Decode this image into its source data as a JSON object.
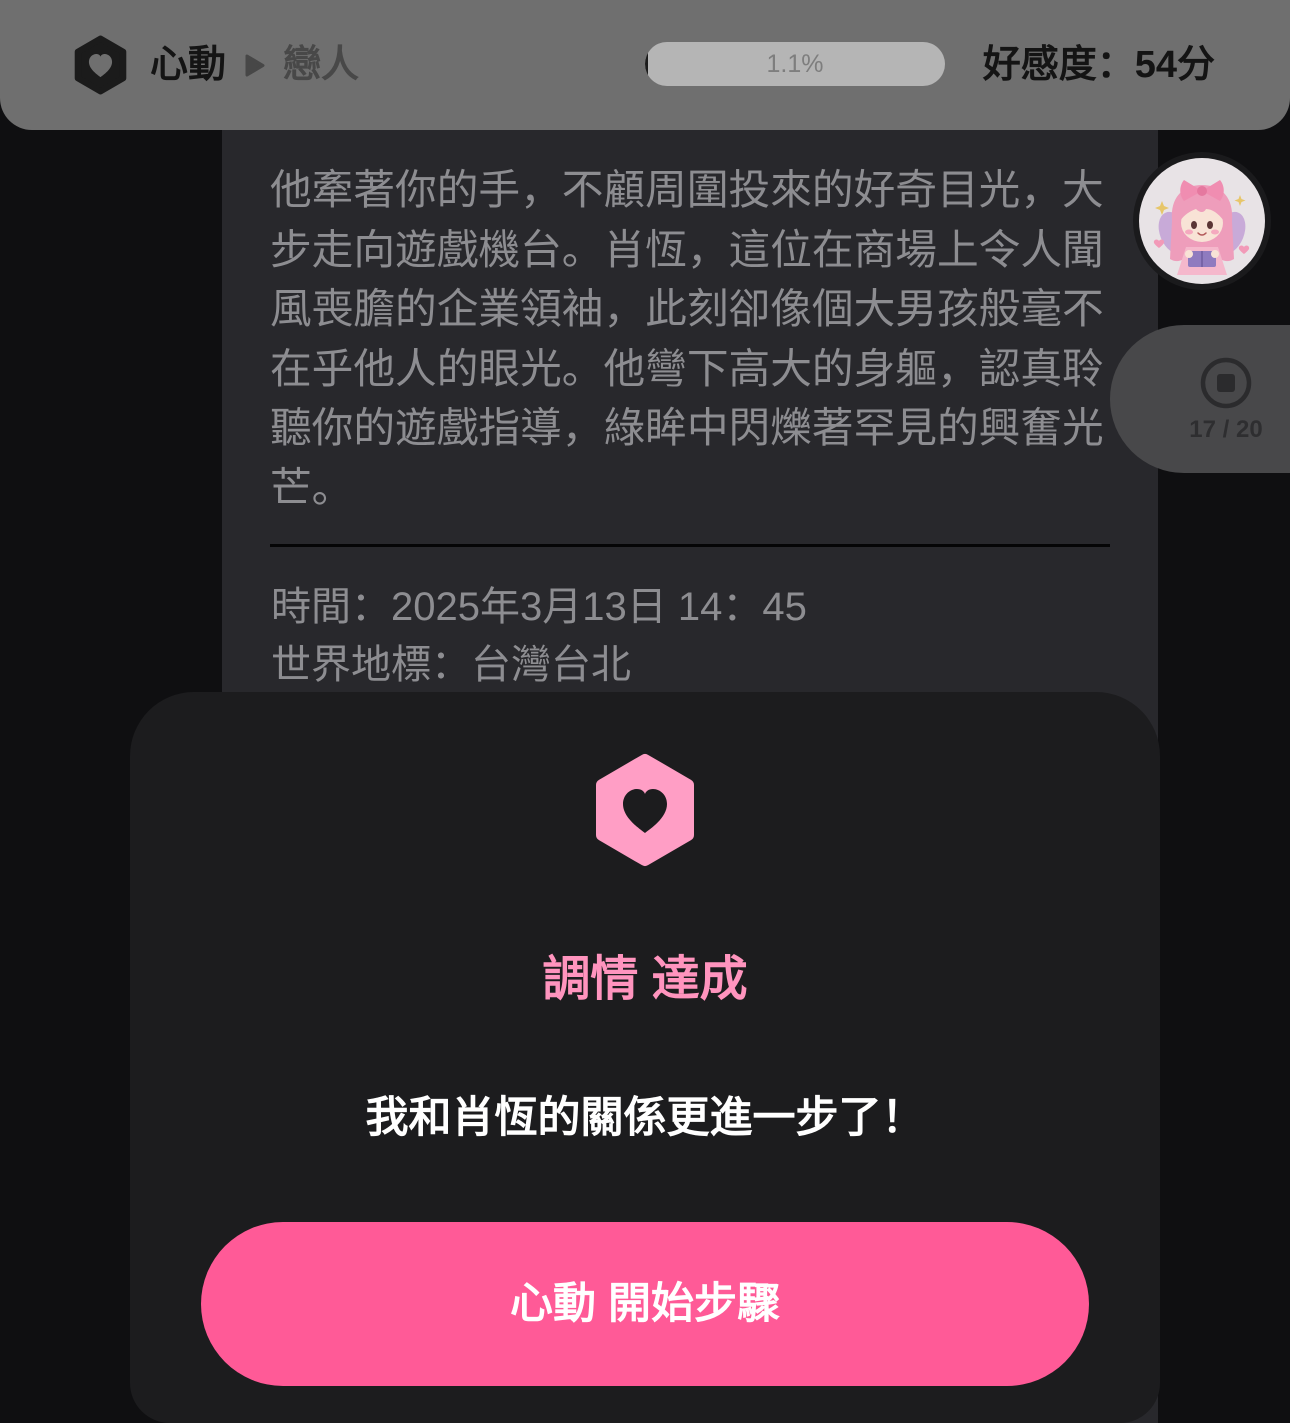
{
  "header": {
    "brand_icon": "heart-hexagon-icon",
    "stage_current": "心動",
    "stage_arrow_icon": "play-arrow-icon",
    "stage_next": "戀人",
    "progress": {
      "label": "1.1%",
      "percent": 1.1
    },
    "affection": "好感度：54分"
  },
  "story": {
    "lines": [
      "他牽著你的手，不顧周圍投來的好奇目光，大",
      "步走向遊戲機台。肖恆，這位在商場上令人聞",
      "風喪膽的企業領袖，此刻卻像個大男孩般毫不",
      "在乎他人的眼光。他彎下高大的身軀，認真聆",
      "聽你的遊戲指導，綠眸中閃爍著罕見的興奮光",
      "芒。"
    ],
    "time": "時間：2025年3月13日 14：45",
    "landmark": "世界地標：台灣台北"
  },
  "side_panel": {
    "avatar_icon": "character-avatar-icon",
    "stop_icon": "stop-circle-icon",
    "counter": "17 / 20"
  },
  "modal": {
    "icon": "heart-hexagon-icon",
    "title": "調情 達成",
    "message": "我和肖恆的關係更進一步了！",
    "button_label": "心動 開始步驟"
  },
  "colors": {
    "background": "#0f0f11",
    "card": "#28282c",
    "header": "#6f6f6f",
    "modal": "#1c1c1e",
    "accent_pink": "#ff5a97",
    "title_pink": "#ff94be",
    "icon_pink": "#ff9ec5",
    "story_text": "#8d8d91"
  }
}
